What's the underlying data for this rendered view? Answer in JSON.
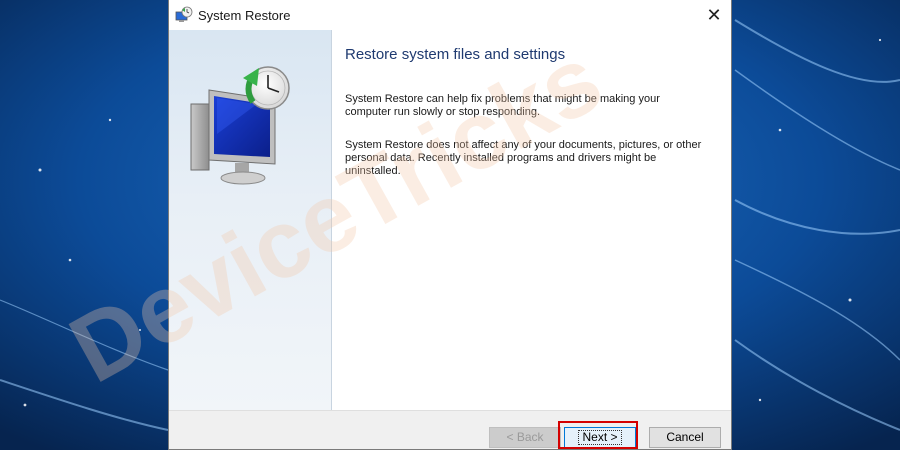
{
  "window": {
    "title": "System Restore",
    "close_glyph": "✕"
  },
  "content": {
    "title": "Restore system files and settings",
    "paragraph_1": "System Restore can help fix problems that might be making your computer run slowly or stop responding.",
    "paragraph_2": "System Restore does not affect any of your documents, pictures, or other personal data. Recently installed programs and drivers might be uninstalled."
  },
  "buttons": {
    "back": "< Back",
    "next": "Next >",
    "cancel": "Cancel"
  },
  "watermark": {
    "text": "DeviceTricks"
  },
  "icons": {
    "title_icon": "system-restore-icon",
    "illustration": "computer-restore-clock-icon"
  },
  "colors": {
    "desktop_bg": "#0a3a78",
    "title_text": "#1f3a70",
    "highlight": "#d40000",
    "watermark": "#f6d7c3"
  }
}
